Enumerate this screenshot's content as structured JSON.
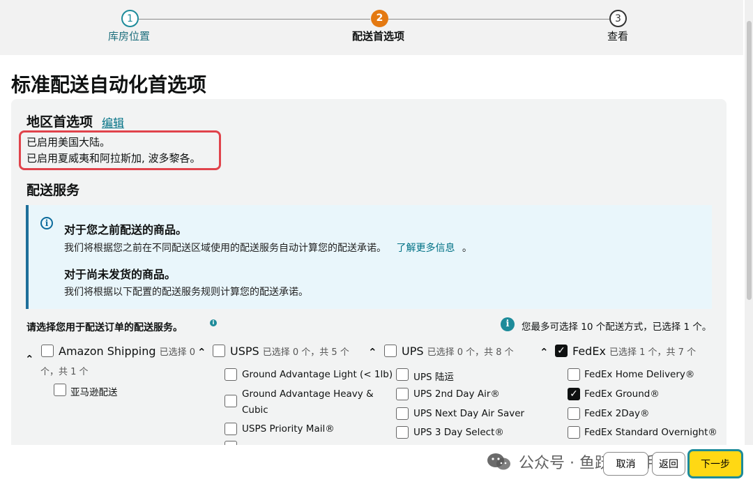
{
  "stepper": {
    "steps": [
      {
        "number": "1",
        "label": "库房位置"
      },
      {
        "number": "2",
        "label": "配送首选项"
      },
      {
        "number": "3",
        "label": "查看"
      }
    ]
  },
  "page_title": "标准配送自动化首选项",
  "region": {
    "heading": "地区首选项",
    "edit_label": "编辑",
    "lines": [
      "已启用美国大陆。",
      "已启用夏威夷和阿拉斯加, 波多黎各。"
    ]
  },
  "services": {
    "heading": "配送服务",
    "info": {
      "heading1": "对于您之前配送的商品。",
      "text1": "我们将根据您之前在不同配送区域使用的配送服务自动计算您的配送承诺。",
      "learn_more": "了解更多信息",
      "text1_tail": "。",
      "heading2": "对于尚未发货的商品。",
      "text2": "我们将根据以下配置的配送服务规则计算您的配送承诺。"
    },
    "select_prompt": "请选择您用于配送订单的配送服务。",
    "limit_note": "您最多可选择 10 个配送方式，已选择 1 个。",
    "carriers": [
      {
        "name": "Amazon Shipping",
        "count": "已选择 0",
        "count_wrap": "个，共 1 个",
        "options": [
          {
            "label": "亚马逊配送",
            "checked": false
          }
        ]
      },
      {
        "name": "USPS",
        "count": "已选择 0 个，共 5 个",
        "options": [
          {
            "label": "Ground Advantage Light (< 1lb)",
            "checked": false
          },
          {
            "label": "Ground Advantage Heavy &",
            "label2": "Cubic",
            "checked": false
          },
          {
            "label": "USPS Priority Mail®",
            "checked": false
          }
        ]
      },
      {
        "name": "UPS",
        "count": "已选择 0 个，共 8 个",
        "options": [
          {
            "label": "UPS 陆运",
            "checked": false
          },
          {
            "label": "UPS 2nd Day Air®",
            "checked": false
          },
          {
            "label": "UPS Next Day Air Saver",
            "checked": false
          },
          {
            "label": "UPS 3 Day Select®",
            "checked": false
          }
        ]
      },
      {
        "name": "FedEx",
        "count": "已选择 1 个，共 7 个",
        "checked": true,
        "options": [
          {
            "label": "FedEx Home Delivery®",
            "checked": false
          },
          {
            "label": "FedEx Ground®",
            "checked": true
          },
          {
            "label": "FedEx 2Day®",
            "checked": false
          },
          {
            "label": "FedEx Standard Overnight®",
            "checked": false
          }
        ]
      }
    ]
  },
  "footer": {
    "cancel": "取消",
    "back": "返回",
    "next": "下一步",
    "watermark": "公众号 · 鱼跃跨境手记"
  }
}
